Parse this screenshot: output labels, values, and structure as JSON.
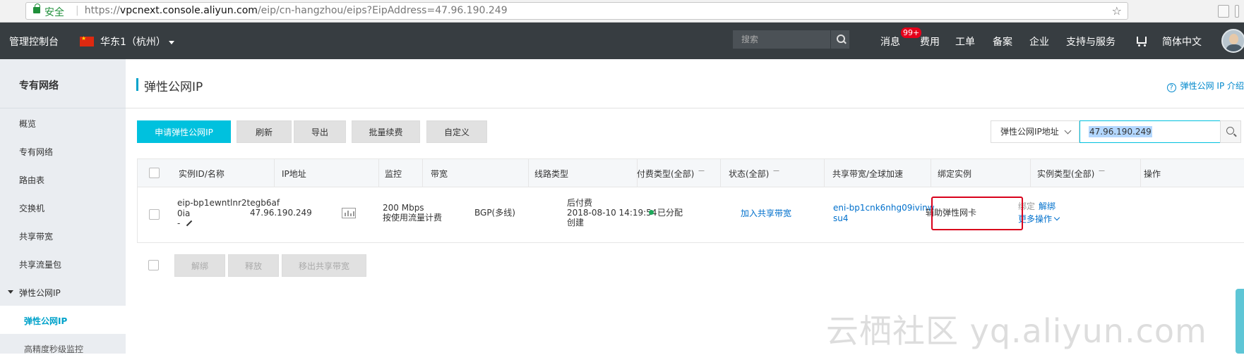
{
  "browser": {
    "secure_label": "安全",
    "url_scheme": "https://",
    "url_host": "vpcnext.console.aliyun.com",
    "url_path": "/eip/cn-hangzhou/eips?EipAddress=47.96.190.249"
  },
  "topnav": {
    "console": "管理控制台",
    "region": "华东1（杭州）",
    "search_placeholder": "搜索",
    "messages": "消息",
    "messages_badge": "99+",
    "billing": "费用",
    "ticket": "工单",
    "icp": "备案",
    "enterprise": "企业",
    "support": "支持与服务",
    "language": "简体中文"
  },
  "sidebar": {
    "title": "专有网络",
    "items": [
      "概览",
      "专有网络",
      "路由表",
      "交换机",
      "共享带宽",
      "共享流量包"
    ],
    "group": "弹性公网IP",
    "active": "弹性公网IP",
    "sub_item": "高精度秒级监控"
  },
  "header": {
    "title": "弹性公网IP",
    "help_link": "弹性公网 IP 介绍"
  },
  "toolbar": {
    "apply": "申请弹性公网IP",
    "refresh": "刷新",
    "export": "导出",
    "batch_renew": "批量续费",
    "customize": "自定义"
  },
  "filter": {
    "field": "弹性公网IP地址",
    "value": "47.96.190.249"
  },
  "table": {
    "columns": [
      "实例ID/名称",
      "IP地址",
      "监控",
      "带宽",
      "线路类型",
      "付费类型(全部)",
      "状态(全部)",
      "共享带宽/全球加速",
      "绑定实例",
      "实例类型(全部)",
      "操作"
    ],
    "rows": [
      {
        "id_line1": "eip-bp1ewntlnr2tegb6af",
        "id_line2": "0ia",
        "name": "-",
        "ip": "47.96.190.249",
        "bandwidth": "200 Mbps",
        "billing_mode": "按使用流量计费",
        "line_type": "BGP(多线)",
        "pay_type": "后付费",
        "created_time": "2018-08-10 14:19:54",
        "created_label": "创建",
        "status": "已分配",
        "shared_bw": "加入共享带宽",
        "bound_line1": "eni-bp1cnk6nhg09ivinw",
        "bound_line2": "su4",
        "instance_type": "辅助弹性网卡",
        "op_bind": "绑定",
        "op_unbind": "解绑",
        "op_more": "更多操作"
      }
    ]
  },
  "bottom_actions": {
    "unbind": "解绑",
    "release": "释放",
    "remove_shared": "移出共享带宽"
  },
  "watermark": "云栖社区 yq.aliyun.com",
  "colors": {
    "nav_bg": "#373d41",
    "accent": "#00c1de",
    "link": "#0070cc",
    "status_ok": "#1daa5b",
    "highlight": "#d9001b"
  }
}
